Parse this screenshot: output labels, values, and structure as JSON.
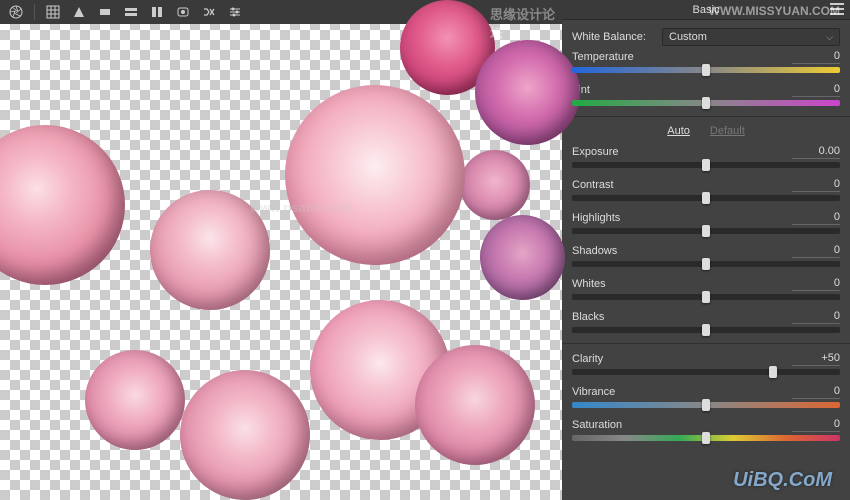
{
  "panel": {
    "title": "Basic",
    "whiteBalance": {
      "label": "White Balance:",
      "value": "Custom"
    },
    "autoLabel": "Auto",
    "defaultLabel": "Default"
  },
  "sliders": {
    "temperature": {
      "label": "Temperature",
      "value": "0",
      "pos": 50
    },
    "tint": {
      "label": "Tint",
      "value": "0",
      "pos": 50
    },
    "exposure": {
      "label": "Exposure",
      "value": "0.00",
      "pos": 50
    },
    "contrast": {
      "label": "Contrast",
      "value": "0",
      "pos": 50
    },
    "highlights": {
      "label": "Highlights",
      "value": "0",
      "pos": 50
    },
    "shadows": {
      "label": "Shadows",
      "value": "0",
      "pos": 50
    },
    "whites": {
      "label": "Whites",
      "value": "0",
      "pos": 50
    },
    "blacks": {
      "label": "Blacks",
      "value": "0",
      "pos": 50
    },
    "clarity": {
      "label": "Clarity",
      "value": "+50",
      "pos": 75
    },
    "vibrance": {
      "label": "Vibrance",
      "value": "0",
      "pos": 50
    },
    "saturation": {
      "label": "Saturation",
      "value": "0",
      "pos": 50
    }
  },
  "watermarks": {
    "w1": "思缘设计论坛",
    "w2": "WWW.MISSYUAN.COM",
    "w3": "UiBQ.CoM",
    "w4": "www.psatm.com"
  }
}
